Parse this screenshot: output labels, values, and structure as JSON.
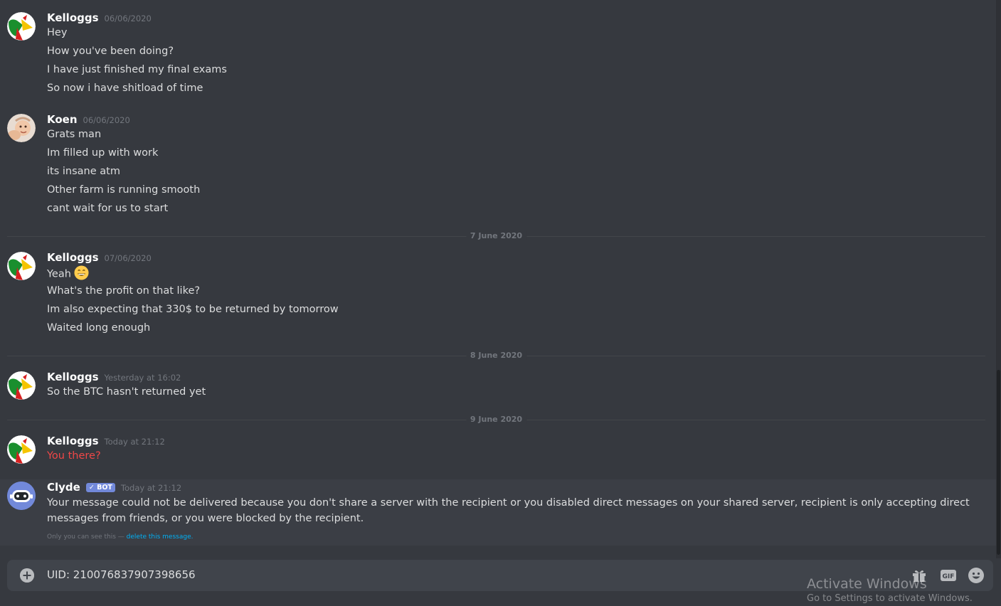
{
  "messages": [
    {
      "author": "Kelloggs",
      "timestamp": "06/06/2020",
      "avatar": "kelloggs-rooster-avatar",
      "lines": [
        "Hey",
        "How you've been doing?",
        "I have just finished my final exams",
        "So now i have shitload of time"
      ]
    },
    {
      "author": "Koen",
      "timestamp": "06/06/2020",
      "avatar": "baby-photo-avatar",
      "lines": [
        "Grats man",
        "Im filled up with work",
        "its insane atm",
        "Other farm is running smooth",
        "cant wait for us to start"
      ]
    },
    {
      "author": "Kelloggs",
      "timestamp": "07/06/2020",
      "avatar": "kelloggs-rooster-avatar",
      "lines": [
        "Yeah",
        "What's the profit on that like?",
        "Im also expecting that 330$ to be returned by tomorrow",
        "Waited long enough"
      ],
      "emoji": "grinning-face-emoji"
    },
    {
      "author": "Kelloggs",
      "timestamp": "Yesterday at 16:02",
      "avatar": "kelloggs-rooster-avatar",
      "lines": [
        "So the BTC hasn't returned yet"
      ]
    },
    {
      "author": "Kelloggs",
      "timestamp": "Today at 21:12",
      "avatar": "kelloggs-rooster-avatar",
      "lines": [
        "You there?"
      ],
      "failed": true
    }
  ],
  "dividers": [
    "7 June 2020",
    "8 June 2020",
    "9 June 2020"
  ],
  "clyde": {
    "author": "Clyde",
    "tag": "✓ BOT",
    "timestamp": "Today at 21:12",
    "text": "Your message could not be delivered because you don't share a server with the recipient or you disabled direct messages on your shared server, recipient is only accepting direct messages from friends, or you were blocked by the recipient.",
    "ephemeral_note": "Only you can see this — ",
    "delete_link": "delete this message."
  },
  "composer": {
    "value": "UID: 210076837907398656",
    "gif_label": "GIF"
  },
  "watermark": {
    "title": "Activate Windows",
    "subtitle": "Go to Settings to activate Windows."
  },
  "colors": {
    "background": "#36393f",
    "failed_text": "#f04747",
    "bot_tag": "#7289da",
    "link": "#00b0f4"
  }
}
